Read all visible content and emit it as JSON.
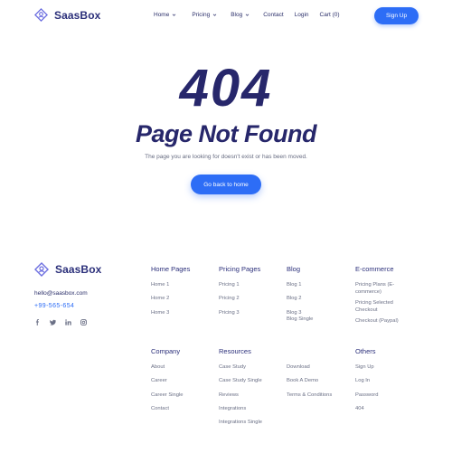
{
  "brand": {
    "name": "SaasBox",
    "accent": "#2d6df6",
    "dark": "#27276b"
  },
  "nav": {
    "items": [
      {
        "label": "Home",
        "dropdown": true
      },
      {
        "label": "Pricing",
        "dropdown": true
      },
      {
        "label": "Blog",
        "dropdown": true
      },
      {
        "label": "Contact",
        "dropdown": false
      },
      {
        "label": "Login",
        "dropdown": false
      },
      {
        "label": "Cart (0)",
        "dropdown": false
      }
    ],
    "signup_label": "Sign Up"
  },
  "hero": {
    "code": "404",
    "title": "Page Not Found",
    "subtitle": "The page you are looking for doesn't exist or has been moved.",
    "button_label": "Go back to home"
  },
  "footer": {
    "email": "hello@saasbox.com",
    "phone": "+99-565-654",
    "socials": [
      "facebook-icon",
      "twitter-icon",
      "linkedin-icon",
      "instagram-icon"
    ],
    "columns": [
      {
        "title": "Home Pages",
        "links": [
          "Home 1",
          "Home 2",
          "Home 3"
        ]
      },
      {
        "title": "Pricing Pages",
        "links": [
          "Pricing 1",
          "Pricing 2",
          "Pricing 3"
        ]
      },
      {
        "title": "Blog",
        "links": [
          "Blog 1",
          "Blog 2",
          "Blog 3",
          "Blog Single"
        ]
      },
      {
        "title": "E-commerce",
        "links": [
          "Pricing Plans (E-commerce)",
          "Pricing Selected Checkout",
          "Checkout (Paypal)"
        ]
      },
      {
        "title": "Company",
        "links": [
          "About",
          "Career",
          "Career Single",
          "Contact"
        ]
      },
      {
        "title": "Resources",
        "links": [
          "Case Study",
          "Case Study Single",
          "Reviews",
          "Integrations",
          "Integrations Single"
        ]
      },
      {
        "title": "",
        "links": [
          "Download",
          "Book A Demo",
          "Terms & Conditions"
        ]
      },
      {
        "title": "Others",
        "links": [
          "Sign Up",
          "Log In",
          "Password",
          "404"
        ]
      }
    ]
  }
}
